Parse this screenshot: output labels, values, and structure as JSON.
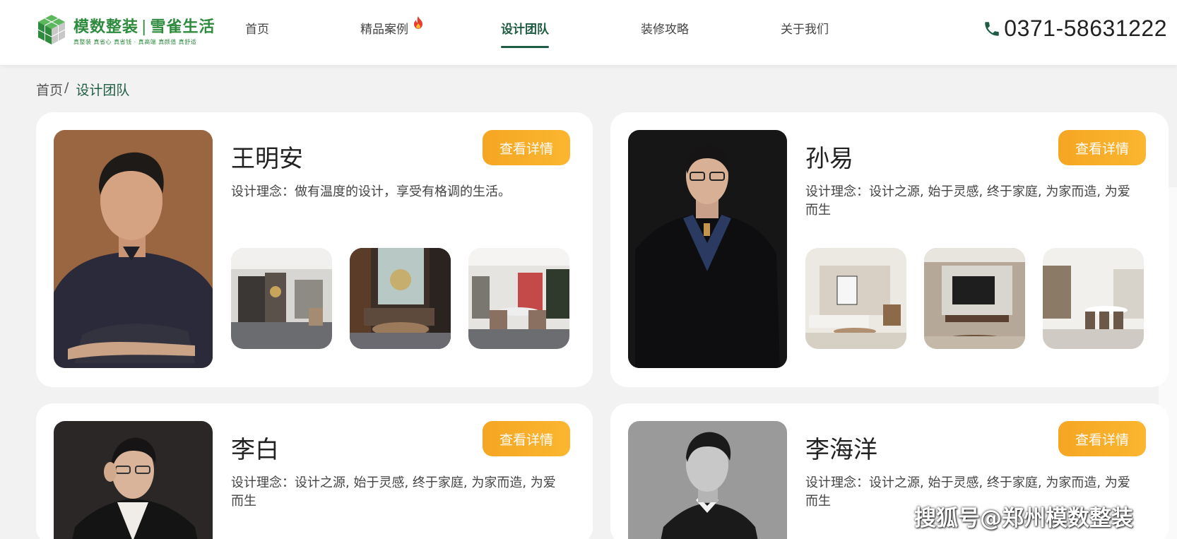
{
  "header": {
    "logo": {
      "brand_main": "模数整装",
      "brand_divider": "|",
      "brand_partner": "雪雀生活",
      "tagline": "真整装 真省心 真省钱 · 真高端 真颜值 真舒适"
    },
    "nav": [
      {
        "label": "首页",
        "active": false,
        "hot": false
      },
      {
        "label": "精品案例",
        "active": false,
        "hot": true
      },
      {
        "label": "设计团队",
        "active": true,
        "hot": false
      },
      {
        "label": "装修攻略",
        "active": false,
        "hot": false
      },
      {
        "label": "关于我们",
        "active": false,
        "hot": false
      }
    ],
    "phone": "0371-58631222"
  },
  "breadcrumb": {
    "home": "首页",
    "separator": "/",
    "current": "设计团队"
  },
  "designers": [
    {
      "name": "王明安",
      "button": "查看详情",
      "philosophy": "设计理念：做有温度的设计，享受有格调的生活。",
      "thumbnails": [
        "living-room-render",
        "lounge-render",
        "dining-room-render"
      ]
    },
    {
      "name": "孙易",
      "button": "查看详情",
      "philosophy": "设计理念：设计之源, 始于灵感, 终于家庭, 为家而造, 为爱而生",
      "thumbnails": [
        "living-room-render",
        "tv-wall-render",
        "dining-room-render"
      ]
    },
    {
      "name": "李白",
      "button": "查看详情",
      "philosophy": "设计理念：设计之源, 始于灵感, 终于家庭, 为家而造, 为爱而生",
      "thumbnails": []
    },
    {
      "name": "李海洋",
      "button": "查看详情",
      "philosophy": "设计理念：设计之源, 始于灵感, 终于家庭, 为家而造, 为爱而生",
      "thumbnails": []
    }
  ],
  "watermark": "搜狐号@郑州模数整装",
  "colors": {
    "brand_green": "#2e8b3e",
    "active_nav": "#1f5c44",
    "button_orange": "#f5a623",
    "page_bg": "#f2f2f2"
  }
}
